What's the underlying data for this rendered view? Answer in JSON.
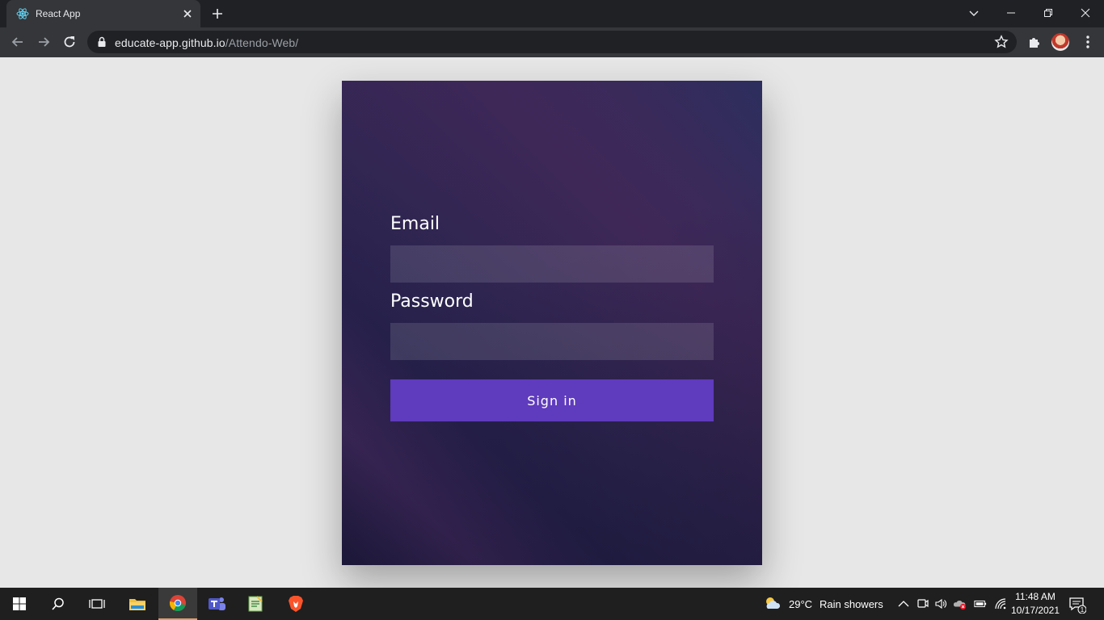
{
  "browser": {
    "tab_title": "React App",
    "url_host": "educate-app.github.io",
    "url_path": "/Attendo-Web/"
  },
  "form": {
    "email_label": "Email",
    "email_value": "",
    "password_label": "Password",
    "password_value": "",
    "signin_label": "Sign in"
  },
  "taskbar": {
    "weather_temp": "29°C",
    "weather_text": "Rain showers",
    "time": "11:48 AM",
    "date": "10/17/2021",
    "notification_count": "1"
  },
  "colors": {
    "button": "#5f3bbd",
    "card_dark": "#1d1a3c",
    "card_purple": "#3f2858"
  }
}
